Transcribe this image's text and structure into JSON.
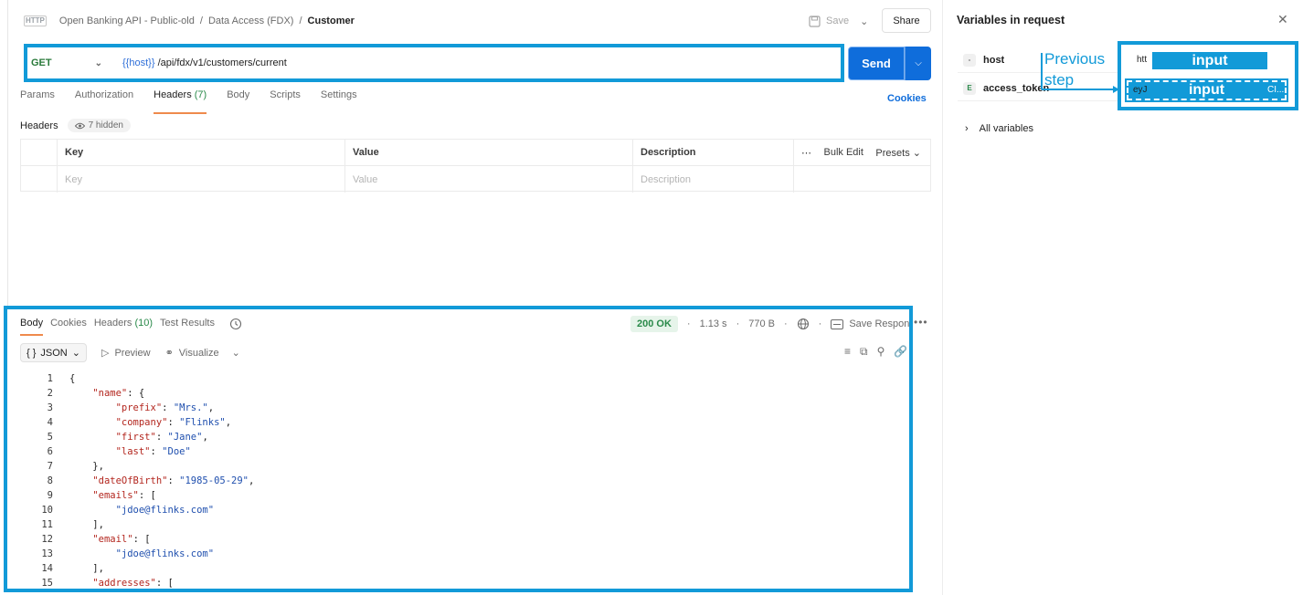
{
  "breadcrumb": {
    "badge": "HTTP",
    "items": [
      "Open Banking API - Public-old",
      "Data Access (FDX)",
      "Customer"
    ],
    "separator": "/"
  },
  "toolbar": {
    "save_label": "Save",
    "share_label": "Share"
  },
  "request": {
    "method": "GET",
    "url_var": "{{host}}",
    "url_path": "/api/fdx/v1/customers/current",
    "send_label": "Send"
  },
  "request_tabs": {
    "params": "Params",
    "authorization": "Authorization",
    "headers": "Headers",
    "headers_count": "(7)",
    "body": "Body",
    "scripts": "Scripts",
    "settings": "Settings",
    "cookies": "Cookies"
  },
  "headers_section": {
    "label": "Headers",
    "hidden": "7 hidden",
    "columns": [
      "Key",
      "Value",
      "Description"
    ],
    "bulk_edit": "Bulk Edit",
    "presets": "Presets",
    "placeholders": [
      "Key",
      "Value",
      "Description"
    ]
  },
  "response": {
    "tabs": {
      "body": "Body",
      "cookies": "Cookies",
      "headers": "Headers",
      "headers_count": "(10)",
      "tests": "Test Results"
    },
    "status": "200 OK",
    "time": "1.13 s",
    "size": "770 B",
    "save_response": "Save Response",
    "format": "JSON",
    "preview": "Preview",
    "visualize": "Visualize",
    "code_lines": [
      "{",
      "    \"name\": {",
      "        \"prefix\": \"Mrs.\",",
      "        \"company\": \"Flinks\",",
      "        \"first\": \"Jane\",",
      "        \"last\": \"Doe\"",
      "    },",
      "    \"dateOfBirth\": \"1985-05-29\",",
      "    \"emails\": [",
      "        \"jdoe@flinks.com\"",
      "    ],",
      "    \"email\": [",
      "        \"jdoe@flinks.com\"",
      "    ],",
      "    \"addresses\": ["
    ]
  },
  "variables_panel": {
    "title": "Variables in request",
    "vars": [
      {
        "badge": "-",
        "name": "host",
        "peek": "htt"
      },
      {
        "badge": "E",
        "name": "access_token",
        "peek": "eyJ",
        "tail": "CI..."
      }
    ],
    "all_variables": "All variables"
  },
  "annotations": {
    "previous_step": [
      "Previous",
      "step"
    ],
    "input_label_1": "input",
    "input_label_2": "input",
    "accent_color": "#129ad8"
  }
}
